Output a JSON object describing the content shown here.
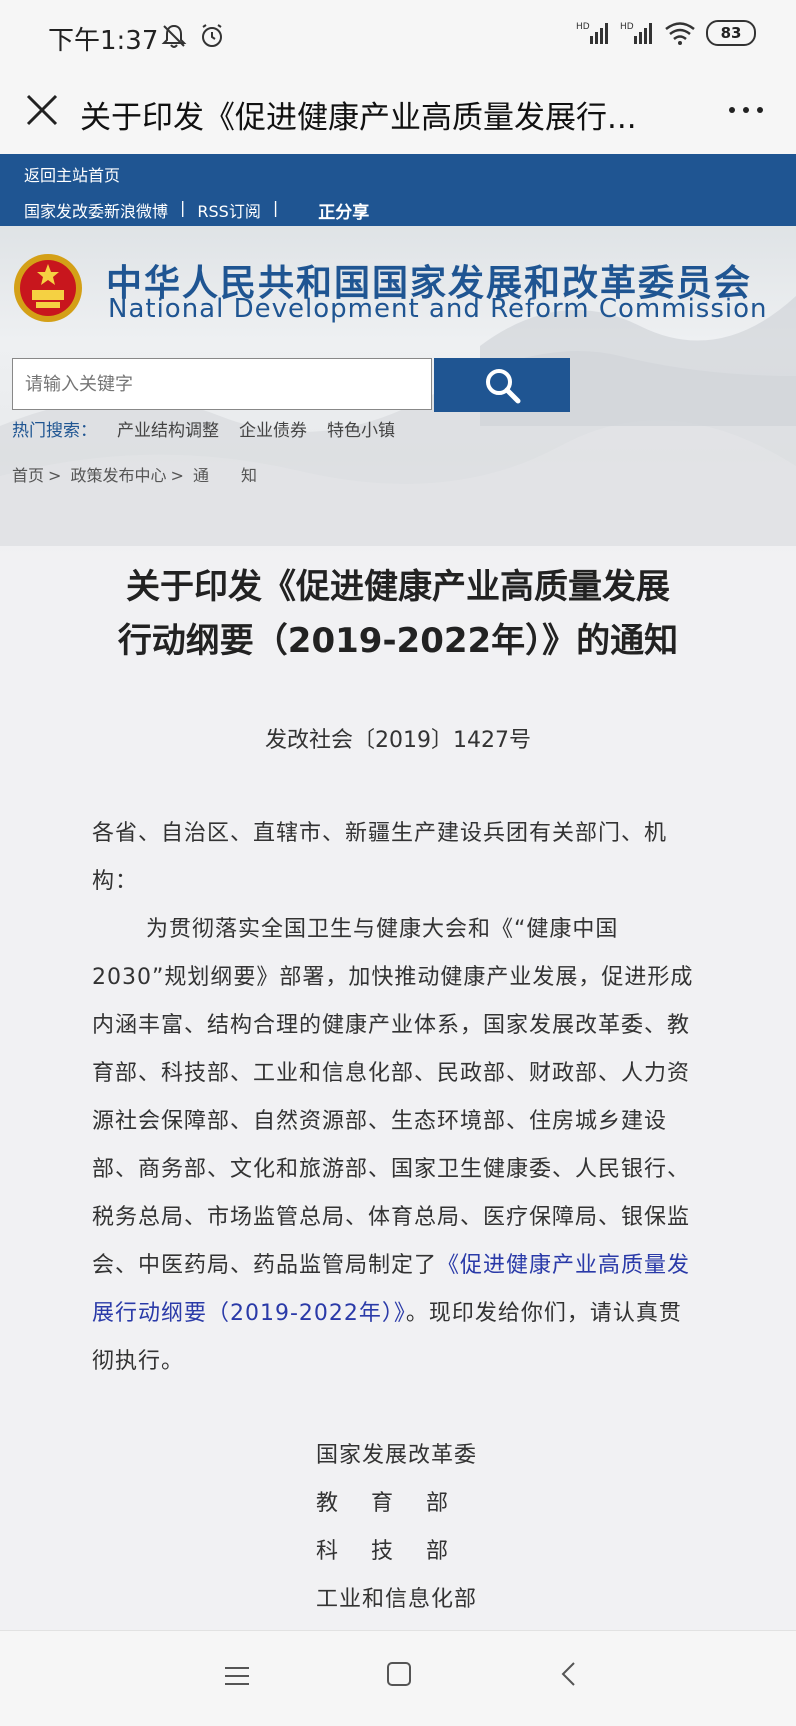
{
  "status": {
    "time": "下午1:37",
    "battery": "83",
    "signal1": "HD",
    "signal2": "HD"
  },
  "titlebar": {
    "title": "关于印发《促进健康产业高质量发展行..."
  },
  "topbar": {
    "home_link": "返回主站首页",
    "weibo": "国家发改委新浪微博",
    "sep1": "|",
    "rss": "RSS订阅",
    "sep2": "|",
    "share": "正分享"
  },
  "header": {
    "name_cn": "中华人民共和国国家发展和改革委员会",
    "name_en": "National Development and Reform Commission"
  },
  "search": {
    "placeholder": "请输入关键字",
    "hot_label": "热门搜索：",
    "hot_keywords": [
      "产业结构调整",
      "企业债券",
      "特色小镇"
    ]
  },
  "breadcrumb": {
    "home": "首页",
    "sep": ">",
    "section": "政策发布中心",
    "current": "通　　知"
  },
  "document": {
    "title_line1": "关于印发《促进健康产业高质量发展",
    "title_line2": "行动纲要（2019-2022年）》的通知",
    "number": "发改社会〔2019〕1427号",
    "salutation": "各省、自治区、直辖市、新疆生产建设兵团有关部门、机构：",
    "body_text": "为贯彻落实全国卫生与健康大会和《“健康中国2030”规划纲要》部署，加快推动健康产业发展，促进形成内涵丰富、结构合理的健康产业体系，国家发展改革委、教育部、科技部、工业和信息化部、民政部、财政部、人力资源社会保障部、自然资源部、生态环境部、住房城乡建设部、商务部、文化和旅游部、国家卫生健康委、人民银行、税务总局、市场监管总局、体育总局、医疗保障局、银保监会、中医药局、药品监管局制定了",
    "body_link": "《促进健康产业高质量发展行动纲要（2019-2022年）》",
    "body_tail": "。现印发给你们，请认真贯彻执行。",
    "signers": [
      "国家发展改革委",
      "教育部",
      "科技部",
      "工业和信息化部"
    ]
  },
  "colors": {
    "brand_blue": "#1f5592",
    "link": "#2a3aa8"
  }
}
